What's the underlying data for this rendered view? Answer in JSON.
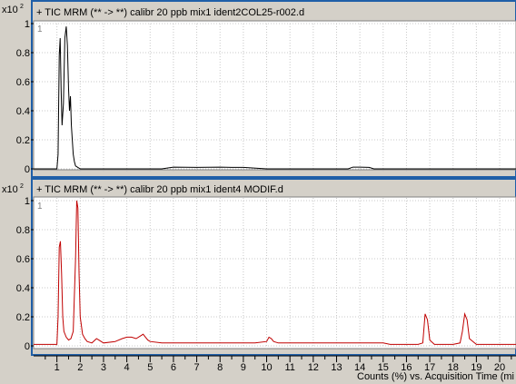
{
  "colors": {
    "background": "#d4d0c8",
    "panel_border": "#1f5fa8",
    "plot_bg": "#ffffff",
    "grid": "#c8c8c8",
    "trace_top": "#000000",
    "trace_bottom": "#c00000"
  },
  "panels": [
    {
      "exponent_label": "x10",
      "exponent_power": "2",
      "title": "+ TIC MRM (** -> **) calibr 20 ppb mix1 ident2COL25-r002.d",
      "index_label": "1"
    },
    {
      "exponent_label": "x10",
      "exponent_power": "2",
      "title": "+ TIC MRM (** -> **) calibr 20 ppb mix1 ident4 MODIF.d",
      "index_label": "1"
    }
  ],
  "x_axis_label": "Counts (%) vs. Acquisition Time (mi",
  "chart_data": [
    {
      "type": "line",
      "title": "+ TIC MRM (** -> **) calibr 20 ppb mix1 ident2COL25-r002.d",
      "xlabel": "",
      "ylabel": "",
      "y_multiplier_label": "x10 2",
      "xlim": [
        0,
        20.7
      ],
      "ylim": [
        0,
        1.0
      ],
      "grid": true,
      "yticks": [
        0,
        0.2,
        0.4,
        0.6,
        0.8,
        1
      ],
      "ytick_labels": [
        "0",
        "0.2",
        "0.4",
        "0.6",
        "0.8",
        "1"
      ],
      "series": [
        {
          "color": "#000000",
          "x": [
            0,
            0.5,
            1.0,
            1.05,
            1.1,
            1.14,
            1.18,
            1.22,
            1.28,
            1.34,
            1.4,
            1.45,
            1.5,
            1.54,
            1.58,
            1.62,
            1.66,
            1.7,
            1.75,
            1.8,
            1.9,
            2.0,
            2.5,
            3.0,
            5.5,
            6.0,
            7.0,
            8.0,
            8.5,
            9.0,
            10.0,
            13.5,
            13.7,
            14.0,
            14.4,
            14.6,
            15.0,
            20.7
          ],
          "y": [
            0,
            0,
            0.0,
            0.1,
            0.78,
            0.9,
            0.55,
            0.3,
            0.45,
            0.9,
            0.98,
            0.85,
            0.55,
            0.4,
            0.5,
            0.3,
            0.2,
            0.1,
            0.05,
            0.02,
            0.01,
            0.0,
            0.0,
            0.0,
            0.0,
            0.012,
            0.01,
            0.012,
            0.01,
            0.01,
            0.0,
            0.0,
            0.012,
            0.012,
            0.01,
            0.0,
            0.0,
            0.0
          ]
        }
      ]
    },
    {
      "type": "line",
      "title": "+ TIC MRM (** -> **) calibr 20 ppb mix1 ident4 MODIF.d",
      "xlabel": "Counts (%) vs. Acquisition Time (mi",
      "ylabel": "",
      "y_multiplier_label": "x10 2",
      "xlim": [
        0,
        20.7
      ],
      "ylim": [
        0,
        1.0
      ],
      "grid": true,
      "yticks": [
        0,
        0.2,
        0.4,
        0.6,
        0.8,
        1
      ],
      "ytick_labels": [
        "0",
        "0.2",
        "0.4",
        "0.6",
        "0.8",
        "1"
      ],
      "xticks": [
        1,
        2,
        3,
        4,
        5,
        6,
        7,
        8,
        9,
        10,
        11,
        12,
        13,
        14,
        15,
        16,
        17,
        18,
        19,
        20
      ],
      "xtick_labels": [
        "1",
        "2",
        "3",
        "4",
        "5",
        "6",
        "7",
        "8",
        "9",
        "10",
        "11",
        "12",
        "13",
        "14",
        "15",
        "16",
        "17",
        "18",
        "19",
        "20"
      ],
      "series": [
        {
          "color": "#c00000",
          "x": [
            0,
            0.5,
            1.0,
            1.05,
            1.1,
            1.15,
            1.2,
            1.25,
            1.3,
            1.4,
            1.5,
            1.6,
            1.7,
            1.8,
            1.85,
            1.9,
            1.95,
            2.0,
            2.1,
            2.2,
            2.3,
            2.5,
            2.7,
            2.8,
            3.0,
            3.5,
            3.8,
            4.0,
            4.2,
            4.4,
            4.6,
            4.7,
            4.8,
            4.9,
            5.0,
            5.5,
            6.0,
            7.0,
            8.0,
            9.0,
            9.5,
            10.0,
            10.1,
            10.2,
            10.3,
            10.5,
            11.0,
            12.0,
            13.0,
            14.0,
            15.0,
            15.3,
            15.5,
            16.0,
            16.5,
            16.7,
            16.8,
            16.9,
            17.0,
            17.2,
            17.5,
            18.0,
            18.3,
            18.4,
            18.5,
            18.6,
            18.7,
            19.0,
            20.0,
            20.7
          ],
          "y": [
            0.01,
            0.01,
            0.01,
            0.2,
            0.68,
            0.72,
            0.5,
            0.2,
            0.1,
            0.06,
            0.04,
            0.05,
            0.1,
            0.6,
            1.0,
            0.95,
            0.5,
            0.2,
            0.08,
            0.05,
            0.03,
            0.02,
            0.05,
            0.04,
            0.02,
            0.03,
            0.05,
            0.06,
            0.06,
            0.05,
            0.07,
            0.08,
            0.06,
            0.04,
            0.03,
            0.02,
            0.02,
            0.02,
            0.02,
            0.02,
            0.02,
            0.03,
            0.06,
            0.05,
            0.03,
            0.02,
            0.02,
            0.02,
            0.02,
            0.02,
            0.02,
            0.01,
            0.01,
            0.01,
            0.01,
            0.02,
            0.22,
            0.18,
            0.04,
            0.01,
            0.01,
            0.01,
            0.02,
            0.1,
            0.22,
            0.18,
            0.05,
            0.01,
            0.01,
            0.01
          ]
        }
      ]
    }
  ]
}
